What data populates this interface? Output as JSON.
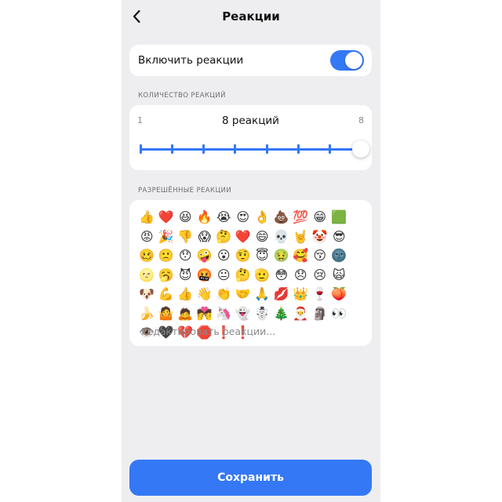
{
  "header": {
    "title": "Реакции",
    "back_icon": "chevron-left-icon"
  },
  "toggle": {
    "label": "Включить реакции",
    "on": true,
    "color": "#3478f6"
  },
  "count_section": {
    "header": "КОЛИЧЕСТВО РЕАКЦИЙ",
    "min": "1",
    "max": "8",
    "label": "8 реакций",
    "value": 8,
    "steps": 8
  },
  "reactions_section": {
    "header": "РАЗРЕШЁННЫЕ РЕАКЦИИ",
    "emojis": [
      "👍",
      "❤️",
      "😆",
      "🔥",
      "😭",
      "😍",
      "👌",
      "💩",
      "💯",
      "😁",
      "🟩",
      "😡",
      "🎉",
      "👎",
      "😱",
      "🤔",
      "❤️",
      "😄",
      "💀",
      "🤘",
      "🤡",
      "😎",
      "🥴",
      "🙁",
      "😯",
      "🤪",
      "😮",
      "🤨",
      "😇",
      "🤢",
      "🥰",
      "😚",
      "🌚",
      "🌝",
      "🥱",
      "😈",
      "🤬",
      "😐",
      "🤔",
      "🫡",
      "😳",
      "😞",
      "😢",
      "🙀",
      "🐶",
      "💪",
      "👍",
      "👋",
      "👏",
      "🤝",
      "🙏",
      "💋",
      "👑",
      "🍷",
      "🍑",
      "🍌",
      "🤷",
      "🙇",
      "💏",
      "🦄",
      "👻",
      "☃️",
      "🎄",
      "🎅",
      "🗿",
      "👀",
      "👁️",
      "🖤",
      "💔",
      "🛑",
      "❗",
      "❗"
    ],
    "edit_label": "Редактировать реакции..."
  },
  "save_button": {
    "label": "Сохранить"
  }
}
